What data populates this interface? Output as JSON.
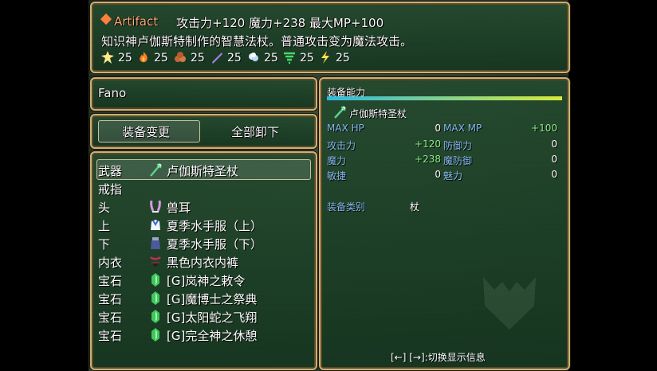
{
  "help": {
    "item_type": "Artifact",
    "effect_line": "攻击力+120 魔力+238 最大MP+100",
    "description": "知识神卢伽斯特制作的智慧法杖。普通攻击变为魔法攻击。",
    "resistances": [
      {
        "icon": "burst-icon",
        "value": "25"
      },
      {
        "icon": "fire-icon",
        "value": "25"
      },
      {
        "icon": "earth-icon",
        "value": "25"
      },
      {
        "icon": "wind-icon",
        "value": "25"
      },
      {
        "icon": "ice-icon",
        "value": "25"
      },
      {
        "icon": "tornado-icon",
        "value": "25"
      },
      {
        "icon": "lightning-icon",
        "value": "25"
      }
    ]
  },
  "actor": {
    "name": "Fano"
  },
  "commands": {
    "equip": "装备变更",
    "unequip_all": "全部卸下"
  },
  "slots": [
    {
      "label": "武器",
      "item": "卢伽斯特圣杖",
      "icon": "staff-icon"
    },
    {
      "label": "戒指",
      "item": "",
      "icon": ""
    },
    {
      "label": "头",
      "item": "兽耳",
      "icon": "bunny-ears-icon"
    },
    {
      "label": "上",
      "item": "夏季水手服（上）",
      "icon": "sailor-top-icon"
    },
    {
      "label": "下",
      "item": "夏季水手服（下）",
      "icon": "sailor-bottom-icon"
    },
    {
      "label": "内衣",
      "item": "黑色内衣内裤",
      "icon": "underwear-icon"
    },
    {
      "label": "宝石",
      "item": "[G]岚神之敕令",
      "icon": "green-gem-icon"
    },
    {
      "label": "宝石",
      "item": "[G]魔博士之祭典",
      "icon": "green-gem-icon"
    },
    {
      "label": "宝石",
      "item": "[G]太阳蛇之飞翔",
      "icon": "green-gem-icon"
    },
    {
      "label": "宝石",
      "item": "[G]完全神之休憩",
      "icon": "green-gem-icon"
    }
  ],
  "status": {
    "header": "装备能力",
    "selected_item": "卢伽斯特圣杖",
    "stats": [
      {
        "label": "MAX HP",
        "value": "0"
      },
      {
        "label": "MAX MP",
        "value": "+100"
      },
      {
        "label": "攻击力",
        "value": "+120"
      },
      {
        "label": "防御力",
        "value": "0"
      },
      {
        "label": "魔力",
        "value": "+238"
      },
      {
        "label": "魔防御",
        "value": "0"
      },
      {
        "label": "敏捷",
        "value": "0"
      },
      {
        "label": "魅力",
        "value": "0"
      }
    ],
    "type_label": "装备类别",
    "type_value": "杖",
    "footer_hint": "[←] [→]:切换显示信息"
  },
  "colors": {
    "accent_orange": "#ffb07a",
    "stat_label_blue": "#84b8ec",
    "increase_green": "#8cf08c",
    "frame_gold": "#c9b27a"
  }
}
